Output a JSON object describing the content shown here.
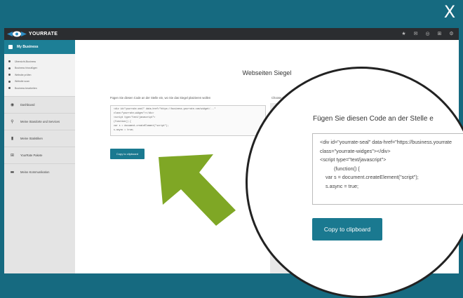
{
  "overlay": {
    "close_label": "X"
  },
  "topbar": {
    "brand": "YOURRATE",
    "icons": [
      "star-icon",
      "chat-icon",
      "globe-icon",
      "cart-icon",
      "gear-icon"
    ],
    "icon_glyphs": [
      "★",
      "✉",
      "◎",
      "⊞",
      "⚙"
    ]
  },
  "sidebar": {
    "header": "My Business",
    "sub_items": [
      "Übersicht-Business",
      "Business hinzufügen",
      "Website prüfen",
      "Website scan",
      "Business bearbeiten"
    ],
    "items": [
      {
        "label": "Dashboard",
        "icon": "dashboard-icon",
        "glyph": "◉"
      },
      {
        "label": "Meine Standorte und Services",
        "icon": "location-pin-icon",
        "glyph": "⚲"
      },
      {
        "label": "Meine Statistiken",
        "icon": "bar-chart-icon",
        "glyph": "▮"
      },
      {
        "label": "YourRate Pakete",
        "icon": "cart-icon",
        "glyph": "⊞"
      },
      {
        "label": "Meine Kommunikation",
        "icon": "message-icon",
        "glyph": "▬"
      }
    ]
  },
  "main": {
    "title": "Webseiten Siegel",
    "instruction": "Fügen Sie diesen Code an der Stelle ein, wo Sie das Siegel platzieren wollen",
    "choose_label": "Choose the seal",
    "code_lines": [
      "<div id=\"yourrate-seal\" data-href=\"https://business.yourrate.com/widget/...\"",
      "class=\"yourrate-widges\"></div>",
      "<script type=\"text/javascript\">",
      "(function() {",
      "var s = document.createElement(\"script\");",
      "s.async = true;"
    ],
    "copy_button": "Copy to clipboard"
  },
  "magnifier": {
    "heading": "Fügen Sie diesen Code an der Stelle e",
    "code_lines": [
      "<div id=\"yourrate-seal\" data-href=\"https://business.yourrate",
      "class=\"yourrate-widges\"></div>",
      "<script type=\"text/javascript\">",
      "(function() {",
      "var s = document.createElement(\"script\");",
      "s.async = true;"
    ],
    "copy_button": "Copy to clipboard"
  },
  "colors": {
    "teal_border": "#166a80",
    "accent": "#1a7990",
    "arrow_green": "#7fa725",
    "topbar": "#2b2d30"
  }
}
